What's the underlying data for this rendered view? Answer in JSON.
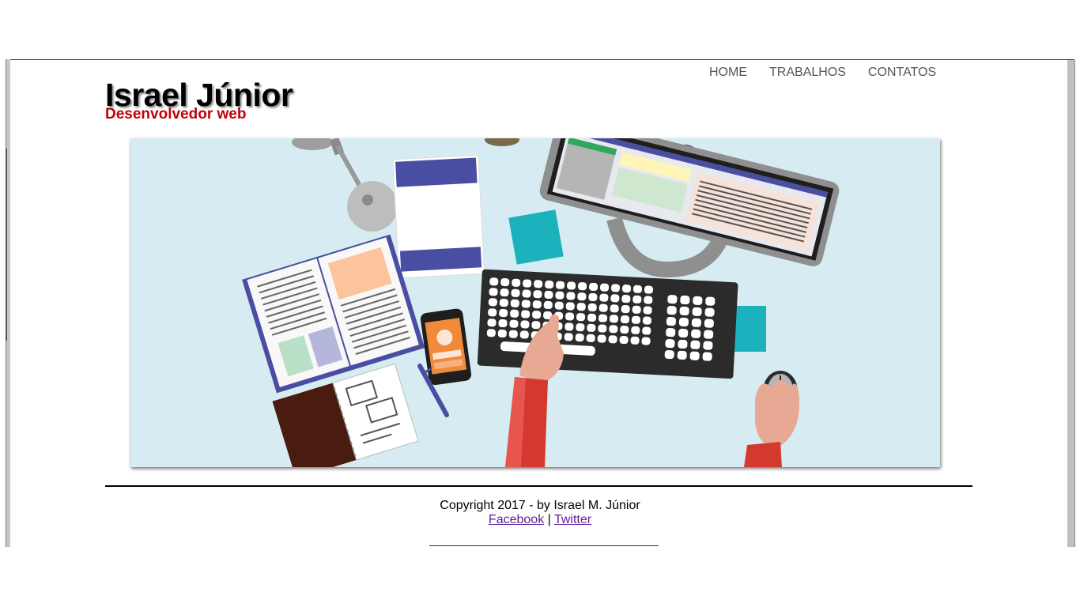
{
  "header": {
    "title": "Israel Júnior",
    "subtitle": "Desenvolvedor web"
  },
  "nav": {
    "items": [
      {
        "label": "HOME"
      },
      {
        "label": "TRABALHOS"
      },
      {
        "label": "CONTATOS"
      }
    ]
  },
  "hero": {
    "alt": "workspace illustration"
  },
  "footer": {
    "copyright": "Copyright 2017 - by Israel M. Júnior",
    "links": [
      {
        "label": "Facebook"
      },
      {
        "label": "Twitter"
      }
    ],
    "separator": "|"
  },
  "colors": {
    "subtitle": "#c0000a",
    "link": "#5b1e9a",
    "hero_bg": "#d7ecf2"
  }
}
